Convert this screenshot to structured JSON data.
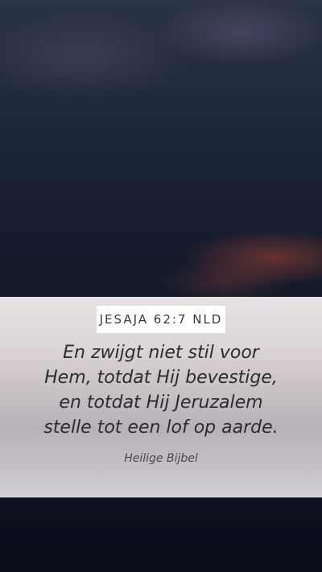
{
  "verse": {
    "reference": "JESAJA 62:7 NLD",
    "lines": [
      "En zwijgt niet stil voor",
      "Hem, totdat Hij bevestige,",
      "en totdat Hij Jeruzalem",
      "stelle tot een lof op aarde."
    ],
    "source": "Heilige Bijbel"
  }
}
